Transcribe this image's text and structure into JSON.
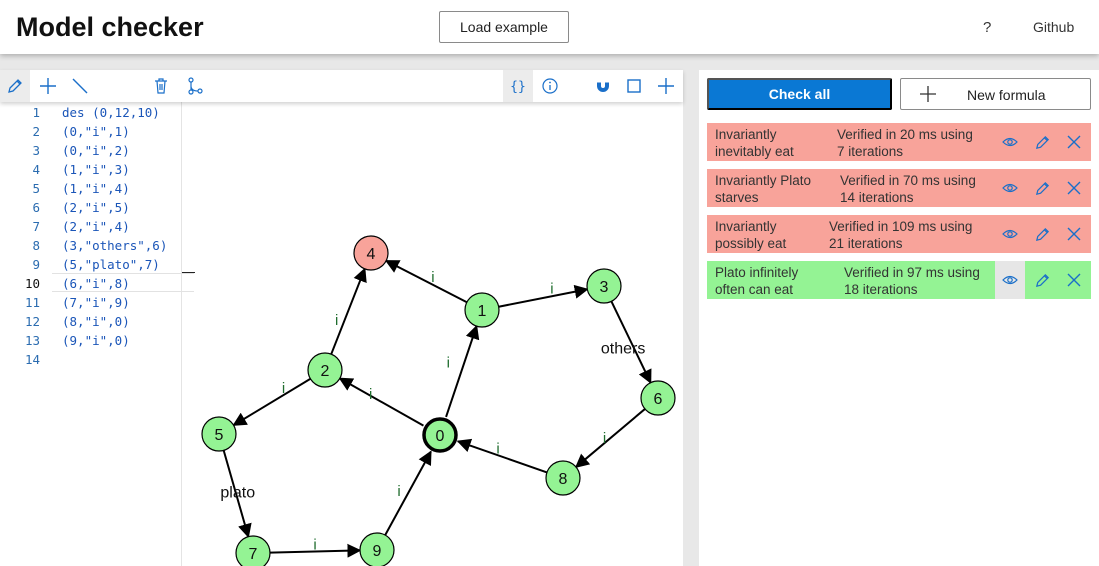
{
  "header": {
    "title": "Model checker",
    "load_example_label": "Load example",
    "help_label": "?",
    "github_label": "Github"
  },
  "editor": {
    "lines": [
      {
        "num": "1",
        "code": "des (0,12,10)"
      },
      {
        "num": "2",
        "code": "(0,\"i\",1)"
      },
      {
        "num": "3",
        "code": "(0,\"i\",2)"
      },
      {
        "num": "4",
        "code": "(1,\"i\",3)"
      },
      {
        "num": "5",
        "code": "(1,\"i\",4)"
      },
      {
        "num": "6",
        "code": "(2,\"i\",5)"
      },
      {
        "num": "7",
        "code": "(2,\"i\",4)"
      },
      {
        "num": "8",
        "code": "(3,\"others\",6)"
      },
      {
        "num": "9",
        "code": "(5,\"plato\",7)"
      },
      {
        "num": "10",
        "code": "(6,\"i\",8)"
      },
      {
        "num": "11",
        "code": "(7,\"i\",9)"
      },
      {
        "num": "12",
        "code": "(8,\"i\",0)"
      },
      {
        "num": "13",
        "code": "(9,\"i\",0)"
      },
      {
        "num": "14",
        "code": ""
      }
    ]
  },
  "graph": {
    "nodes": [
      {
        "id": "0",
        "initial": true,
        "color": "#94f394"
      },
      {
        "id": "1",
        "color": "#94f394"
      },
      {
        "id": "2",
        "color": "#94f394"
      },
      {
        "id": "3",
        "color": "#94f394"
      },
      {
        "id": "4",
        "color": "#f8a39a"
      },
      {
        "id": "5",
        "color": "#94f394"
      },
      {
        "id": "6",
        "color": "#94f394"
      },
      {
        "id": "7",
        "color": "#94f394"
      },
      {
        "id": "8",
        "color": "#94f394"
      },
      {
        "id": "9",
        "color": "#94f394"
      }
    ],
    "edges": [
      {
        "from": "0",
        "to": "1",
        "label": "i"
      },
      {
        "from": "0",
        "to": "2",
        "label": "i"
      },
      {
        "from": "1",
        "to": "3",
        "label": "i"
      },
      {
        "from": "1",
        "to": "4",
        "label": "i"
      },
      {
        "from": "2",
        "to": "5",
        "label": "i"
      },
      {
        "from": "2",
        "to": "4",
        "label": "i"
      },
      {
        "from": "3",
        "to": "6",
        "label": "others"
      },
      {
        "from": "5",
        "to": "7",
        "label": "plato"
      },
      {
        "from": "6",
        "to": "8",
        "label": "i"
      },
      {
        "from": "7",
        "to": "9",
        "label": "i"
      },
      {
        "from": "8",
        "to": "0",
        "label": "i"
      },
      {
        "from": "9",
        "to": "0",
        "label": "i"
      }
    ]
  },
  "formulas_panel": {
    "check_all_label": "Check all",
    "new_formula_label": "New formula",
    "formulas": [
      {
        "name": "Invariantly\ninevitably eat",
        "status": "Verified in 20 ms using\n7 iterations",
        "result": "false"
      },
      {
        "name": "Invariantly Plato\nstarves",
        "status": "Verified in 70 ms using\n14 iterations",
        "result": "false"
      },
      {
        "name": "Invariantly\npossibly eat",
        "status": "Verified in 109 ms using\n21 iterations",
        "result": "false"
      },
      {
        "name": "Plato infinitely\noften can eat",
        "status": "Verified in 97 ms using\n18 iterations",
        "result": "true"
      }
    ]
  },
  "colors": {
    "accent": "#0a78d4",
    "false_result": "#f8a39a",
    "true_result": "#94f394",
    "icon_blue": "#1a6fc9"
  },
  "icons": {
    "toolbar": [
      "pencil-icon",
      "plus-icon",
      "line-icon",
      "trash-icon",
      "branch-icon",
      "braces-icon",
      "info-icon",
      "magnet-icon",
      "square-icon",
      "plus-icon"
    ],
    "formula_actions": [
      "eye-icon",
      "pencil-icon",
      "close-icon"
    ]
  }
}
